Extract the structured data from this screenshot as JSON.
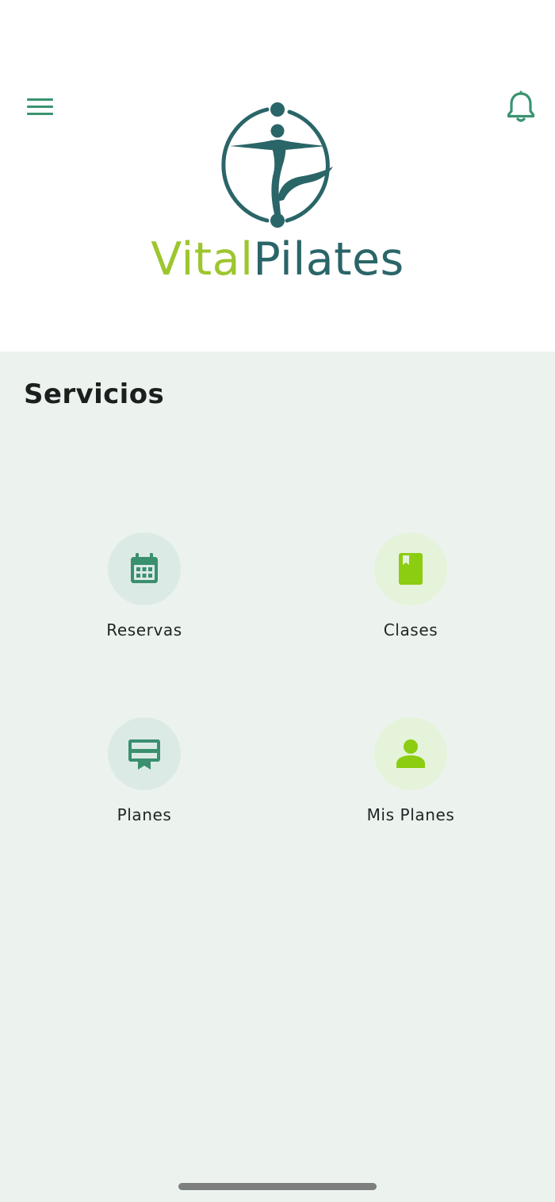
{
  "app": {
    "brand": {
      "part1": "Vital",
      "part2": "Pilates",
      "color_part1": "#9dc62e",
      "color_part2": "#2a6568"
    },
    "header": {
      "menu_icon": "hamburger-menu-icon",
      "notifications_icon": "bell-icon",
      "icon_color": "#3a9470"
    }
  },
  "main": {
    "section_title": "Servicios",
    "services": [
      {
        "label": "Reservas",
        "icon": "calendar-icon",
        "icon_color": "#3a8f6f",
        "circle_color": "#dceae6"
      },
      {
        "label": "Clases",
        "icon": "book-icon",
        "icon_color": "#8ccc11",
        "circle_color": "#e5f3da"
      },
      {
        "label": "Planes",
        "icon": "card-membership-icon",
        "icon_color": "#3a8f6f",
        "circle_color": "#dceae6"
      },
      {
        "label": "Mis Planes",
        "icon": "person-icon",
        "icon_color": "#8ccc11",
        "circle_color": "#e5f3da"
      }
    ]
  },
  "colors": {
    "page_background": "#ecf3ef",
    "header_background": "#ffffff"
  }
}
